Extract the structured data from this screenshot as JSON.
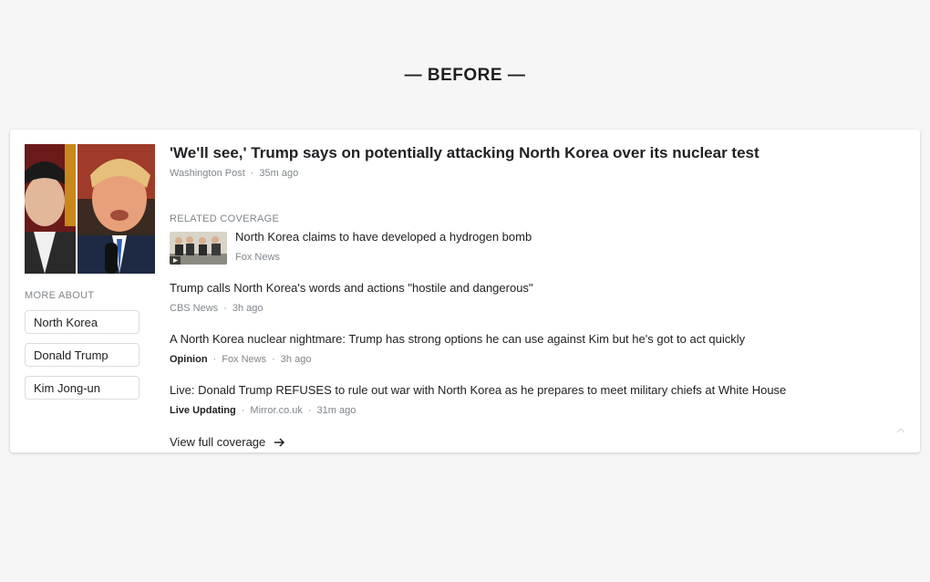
{
  "heading": "— BEFORE —",
  "card": {
    "more_about_label": "MORE ABOUT",
    "topics": [
      "North Korea",
      "Donald Trump",
      "Kim Jong-un"
    ],
    "main_story": {
      "title": "'We'll see,' Trump says on potentially attacking North Korea over its nuclear test",
      "source": "Washington Post",
      "time": "35m ago"
    },
    "related_label": "RELATED COVERAGE",
    "related_story": {
      "title": "North Korea claims to have developed a hydrogen bomb",
      "source": "Fox News"
    },
    "stories": [
      {
        "title": "Trump calls North Korea's words and actions \"hostile and dangerous\"",
        "tag": "",
        "source": "CBS News",
        "time": "3h ago"
      },
      {
        "title": "A North Korea nuclear nightmare: Trump has strong options he can use against Kim but he's got to act quickly",
        "tag": "Opinion",
        "source": "Fox News",
        "time": "3h ago"
      },
      {
        "title": "Live: Donald Trump REFUSES to rule out war with North Korea as he prepares to meet military chiefs at White House",
        "tag": "Live Updating",
        "source": "Mirror.co.uk",
        "time": "31m ago"
      }
    ],
    "view_full_coverage": "View full coverage",
    "icons": {
      "arrow": "arrow-right-icon",
      "collapse": "chevron-up-icon"
    }
  }
}
